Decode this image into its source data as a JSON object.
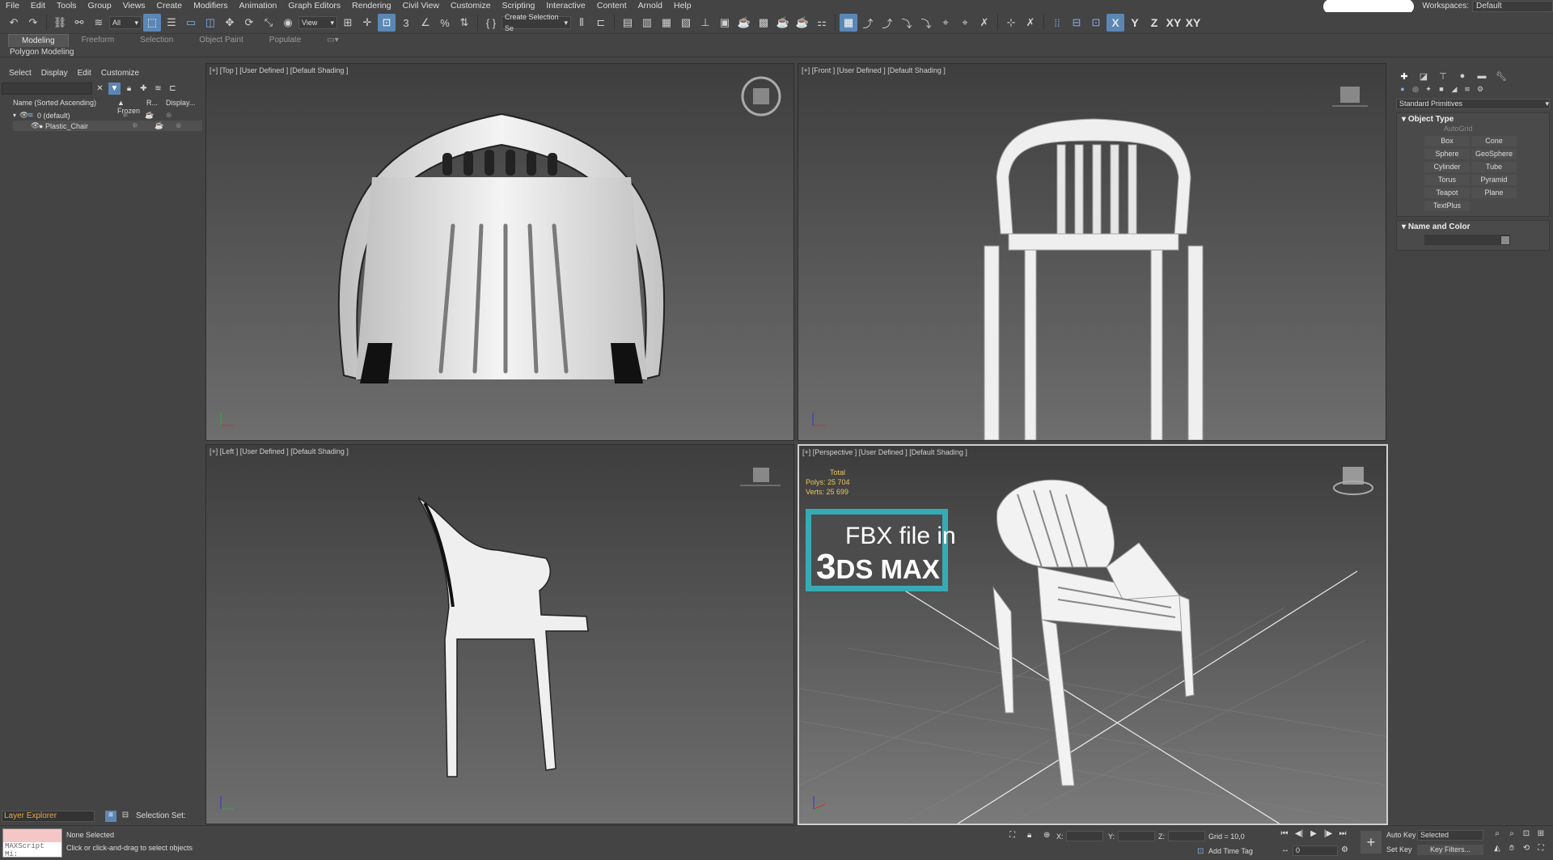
{
  "menu": [
    "File",
    "Edit",
    "Tools",
    "Group",
    "Views",
    "Create",
    "Modifiers",
    "Animation",
    "Graph Editors",
    "Rendering",
    "Civil View",
    "Customize",
    "Scripting",
    "Interactive",
    "Content",
    "Arnold",
    "Help"
  ],
  "workspace": {
    "label": "Workspaces:",
    "value": "Default"
  },
  "toolbar": {
    "filter": "All",
    "view": "View",
    "selection_set": "Create Selection Se",
    "axes": [
      "X",
      "Y",
      "Z",
      "XY",
      "XY"
    ]
  },
  "ribbon": {
    "tabs": [
      "Modeling",
      "Freeform",
      "Selection",
      "Object Paint",
      "Populate"
    ],
    "sub": "Polygon Modeling"
  },
  "scene_explorer": {
    "menu": [
      "Select",
      "Display",
      "Edit",
      "Customize"
    ],
    "columns": [
      "Name (Sorted Ascending)",
      "▲ Frozen",
      "R...",
      "Display..."
    ],
    "rows": [
      {
        "name": "0 (default)"
      },
      {
        "name": "Plastic_Chair"
      }
    ],
    "layer_explorer": "Layer Explorer",
    "selection_set": "Selection Set:"
  },
  "viewports": {
    "top": "[+] [Top ] [User Defined ] [Default Shading ]",
    "front": "[+] [Front ] [User Defined ] [Default Shading ]",
    "left": "[+] [Left ] [User Defined ] [Default Shading ]",
    "perspective": "[+] [Perspective ] [User Defined ] [Default Shading ]"
  },
  "stats": {
    "total": "Total",
    "polys_label": "Polys:",
    "polys": "25 704",
    "verts_label": "Verts:",
    "verts": "25 699"
  },
  "banner": {
    "line1": "FBX file in",
    "line2_big": "3",
    "line2": "DS MAX"
  },
  "command_panel": {
    "dropdown": "Standard Primitives",
    "object_type": "Object Type",
    "autogrid": "AutoGrid",
    "buttons": [
      "Box",
      "Cone",
      "Sphere",
      "GeoSphere",
      "Cylinder",
      "Tube",
      "Torus",
      "Pyramid",
      "Teapot",
      "Plane",
      "TextPlus"
    ],
    "name_color": "Name and Color"
  },
  "status": {
    "maxscript": "MAXScript Mi:",
    "selected": "None Selected",
    "hint": "Click or click-and-drag to select objects",
    "x": "X:",
    "y": "Y:",
    "z": "Z:",
    "grid": "Grid = 10,0",
    "add_time_tag": "Add Time Tag",
    "auto_key": "Auto Key",
    "set_key": "Set Key",
    "selected_drop": "Selected",
    "key_filters": "Key Filters...",
    "frame": "0"
  },
  "colors": {
    "accent": "#5b87b5",
    "banner": "#37abb5",
    "stats": "#e8c85a",
    "layer": "#e8a84a"
  }
}
